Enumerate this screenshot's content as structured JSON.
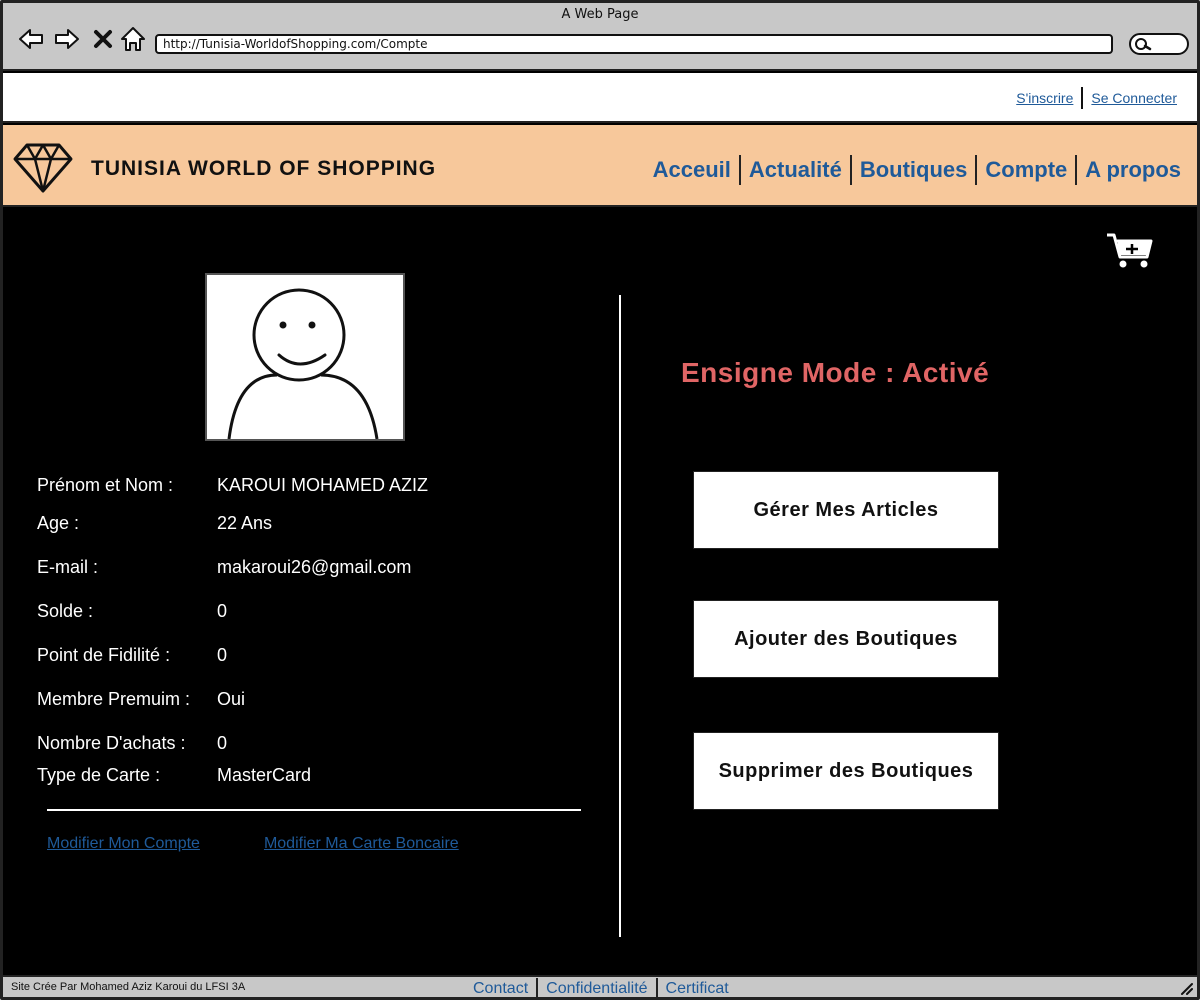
{
  "window": {
    "title": "A Web Page",
    "url": "http://Tunisia-WorldofShopping.com/Compte"
  },
  "auth": {
    "signup": "S'inscrire",
    "login": "Se Connecter"
  },
  "header": {
    "brand": "TUNISIA WORLD OF SHOPPING",
    "nav": [
      "Acceuil",
      "Actualité",
      "Boutiques",
      "Compte",
      "A propos"
    ]
  },
  "profile": {
    "fields": [
      {
        "label": "Prénom et Nom :",
        "value": "KAROUI MOHAMED AZIZ"
      },
      {
        "label": "Age :",
        "value": "22 Ans"
      },
      {
        "label": "E-mail :",
        "value": "makaroui26@gmail.com"
      },
      {
        "label": "Solde :",
        "value": "0"
      },
      {
        "label": "Point de Fidilité :",
        "value": "0"
      },
      {
        "label": "Membre Premuim :",
        "value": "Oui"
      },
      {
        "label": "Nombre D'achats :",
        "value": "0"
      },
      {
        "label": "Type de Carte :",
        "value": "MasterCard"
      }
    ],
    "links": {
      "edit_account": "Modifier Mon Compte",
      "edit_card": "Modifier Ma Carte Boncaire"
    }
  },
  "merchant": {
    "mode_status": "Ensigne Mode : Activé",
    "buttons": [
      "Gérer Mes Articles",
      "Ajouter des Boutiques",
      "Supprimer des Boutiques"
    ]
  },
  "footer": {
    "credit": "Site Crée Par Mohamed Aziz Karoui du LFSI 3A",
    "links": [
      "Contact",
      "Confidentialité",
      "Certificat"
    ]
  },
  "colors": {
    "header_bg": "#f7c89b",
    "link": "#1f5a99",
    "mode_status": "#e06565",
    "content_bg": "#000000"
  },
  "icons": [
    "back-icon",
    "forward-icon",
    "close-icon",
    "home-icon",
    "search-icon",
    "diamond-logo-icon",
    "cart-add-icon",
    "avatar-icon",
    "resize-grip-icon"
  ]
}
